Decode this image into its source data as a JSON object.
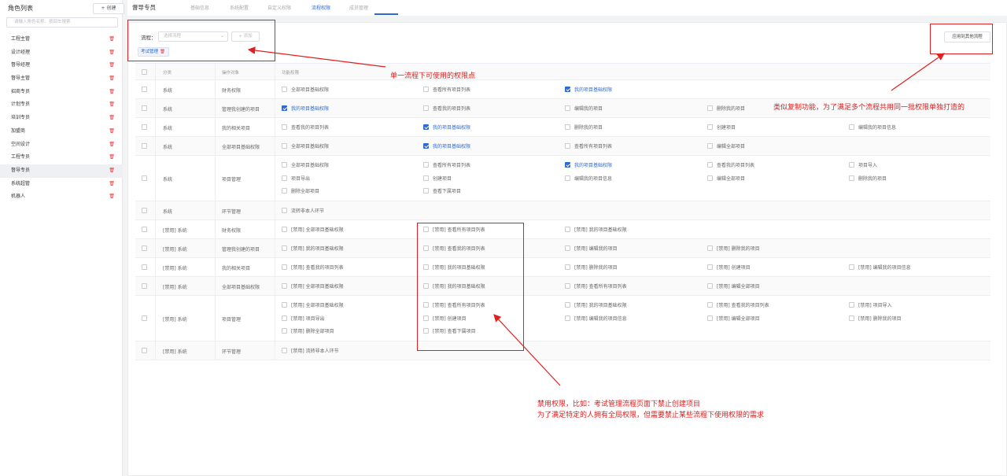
{
  "sidebar": {
    "title": "角色列表",
    "create_label": "+ 创建",
    "search_placeholder": "请输入角色名称、按回车搜索",
    "roles": [
      "工程主管",
      "设计经理",
      "督导经理",
      "督导主管",
      "招商专员",
      "计划专员",
      "培训专员",
      "加盟商",
      "空间设计",
      "工程专员",
      "督导专员",
      "系统超管",
      "机器人"
    ],
    "active_index": 10
  },
  "header": {
    "breadcrumb": "督导专员",
    "tabs": [
      "基础信息",
      "系统配置",
      "自定义权限",
      "流程权限",
      "成员管理"
    ],
    "active_tab": 3
  },
  "flow": {
    "label": "流程：",
    "select_placeholder": "选择流程",
    "add_label": "+ 添加",
    "chip": "考试管理",
    "apply_label": "应用到其他流程"
  },
  "table": {
    "headers": [
      "分类",
      "操作对象",
      "功能权限"
    ],
    "rows": [
      {
        "category": "系统",
        "object": "财务权限",
        "perms": [
          [
            {
              "t": "全部项目基础权限",
              "c": false
            },
            {
              "t": "查看所有项目列表",
              "c": false
            },
            {
              "t": "我的项目基础权限",
              "c": true
            }
          ]
        ]
      },
      {
        "category": "系统",
        "object": "管理我创建的项目",
        "perms": [
          [
            {
              "t": "我的项目基础权限",
              "c": true
            },
            {
              "t": "查看我的项目列表",
              "c": false
            },
            {
              "t": "编辑我的项目",
              "c": false
            },
            {
              "t": "删除我的项目",
              "c": false
            }
          ]
        ]
      },
      {
        "category": "系统",
        "object": "我的相关项目",
        "perms": [
          [
            {
              "t": "查看我的项目列表",
              "c": false
            },
            {
              "t": "我的项目基础权限",
              "c": true
            },
            {
              "t": "删除我的项目",
              "c": false
            },
            {
              "t": "创建项目",
              "c": false
            },
            {
              "t": "编辑我的项目信息",
              "c": false
            }
          ]
        ]
      },
      {
        "category": "系统",
        "object": "全部项目基础权限",
        "perms": [
          [
            {
              "t": "全部项目基础权限",
              "c": false
            },
            {
              "t": "我的项目基础权限",
              "c": true
            },
            {
              "t": "查看所有项目列表",
              "c": false
            },
            {
              "t": "编辑全部项目",
              "c": false
            }
          ]
        ]
      },
      {
        "category": "系统",
        "object": "项目管理",
        "perms": [
          [
            {
              "t": "全部项目基础权限",
              "c": false
            },
            {
              "t": "查看所有项目列表",
              "c": false
            },
            {
              "t": "我的项目基础权限",
              "c": true
            },
            {
              "t": "查看我的项目列表",
              "c": false
            },
            {
              "t": "项目导入",
              "c": false
            }
          ],
          [
            {
              "t": "项目导出",
              "c": false
            },
            {
              "t": "创建项目",
              "c": false
            },
            {
              "t": "编辑我的项目信息",
              "c": false
            },
            {
              "t": "编辑全部项目",
              "c": false
            },
            {
              "t": "删除我的项目",
              "c": false
            }
          ],
          [
            {
              "t": "删除全部项目",
              "c": false
            },
            {
              "t": "查看下属项目",
              "c": false
            }
          ]
        ]
      },
      {
        "category": "系统",
        "object": "环节管理",
        "perms": [
          [
            {
              "t": "流转非本人环节",
              "c": false
            }
          ]
        ]
      },
      {
        "category": "[禁用] 系统",
        "object": "财务权限",
        "perms": [
          [
            {
              "t": "[禁用] 全部项目基础权限",
              "c": false
            },
            {
              "t": "[禁用] 查看所有项目列表",
              "c": false
            },
            {
              "t": "[禁用] 我的项目基础权限",
              "c": false
            }
          ]
        ]
      },
      {
        "category": "[禁用] 系统",
        "object": "管理我创建的项目",
        "perms": [
          [
            {
              "t": "[禁用] 我的项目基础权限",
              "c": false
            },
            {
              "t": "[禁用] 查看我的项目列表",
              "c": false
            },
            {
              "t": "[禁用] 编辑我的项目",
              "c": false
            },
            {
              "t": "[禁用] 删除我的项目",
              "c": false
            }
          ]
        ]
      },
      {
        "category": "[禁用] 系统",
        "object": "我的相关项目",
        "perms": [
          [
            {
              "t": "[禁用] 查看我的项目列表",
              "c": false
            },
            {
              "t": "[禁用] 我的项目基础权限",
              "c": false
            },
            {
              "t": "[禁用] 删除我的项目",
              "c": false
            },
            {
              "t": "[禁用] 创建项目",
              "c": false
            },
            {
              "t": "[禁用] 编辑我的项目信息",
              "c": false
            }
          ]
        ]
      },
      {
        "category": "[禁用] 系统",
        "object": "全部项目基础权限",
        "perms": [
          [
            {
              "t": "[禁用] 全部项目基础权限",
              "c": false
            },
            {
              "t": "[禁用] 我的项目基础权限",
              "c": false
            },
            {
              "t": "[禁用] 查看所有项目列表",
              "c": false
            },
            {
              "t": "[禁用] 编辑全部项目",
              "c": false
            }
          ]
        ]
      },
      {
        "category": "[禁用] 系统",
        "object": "项目管理",
        "perms": [
          [
            {
              "t": "[禁用] 全部项目基础权限",
              "c": false
            },
            {
              "t": "[禁用] 查看所有项目列表",
              "c": false
            },
            {
              "t": "[禁用] 我的项目基础权限",
              "c": false
            },
            {
              "t": "[禁用] 查看我的项目列表",
              "c": false
            },
            {
              "t": "[禁用] 项目导入",
              "c": false
            }
          ],
          [
            {
              "t": "[禁用] 项目导出",
              "c": false
            },
            {
              "t": "[禁用] 创建项目",
              "c": false
            },
            {
              "t": "[禁用] 编辑我的项目信息",
              "c": false
            },
            {
              "t": "[禁用] 编辑全部项目",
              "c": false
            },
            {
              "t": "[禁用] 删除我的项目",
              "c": false
            }
          ],
          [
            {
              "t": "[禁用] 删除全部项目",
              "c": false
            },
            {
              "t": "[禁用] 查看下属项目",
              "c": false
            }
          ]
        ]
      },
      {
        "category": "[禁用] 系统",
        "object": "环节管理",
        "perms": [
          [
            {
              "t": "[禁用] 流转非本人环节",
              "c": false
            }
          ]
        ]
      }
    ]
  },
  "annotations": {
    "single_flow": "单一流程下可使用的权限点",
    "copy_feature": "类似复制功能，为了满足多个流程共用同一批权限单独打造的",
    "disable_line1": "禁用权限，比如：考试管理流程页面下禁止创建项目",
    "disable_line2": "为了满足特定的人拥有全局权限，但需要禁止某些流程下使用权限的需求",
    "color": "#e02020"
  }
}
